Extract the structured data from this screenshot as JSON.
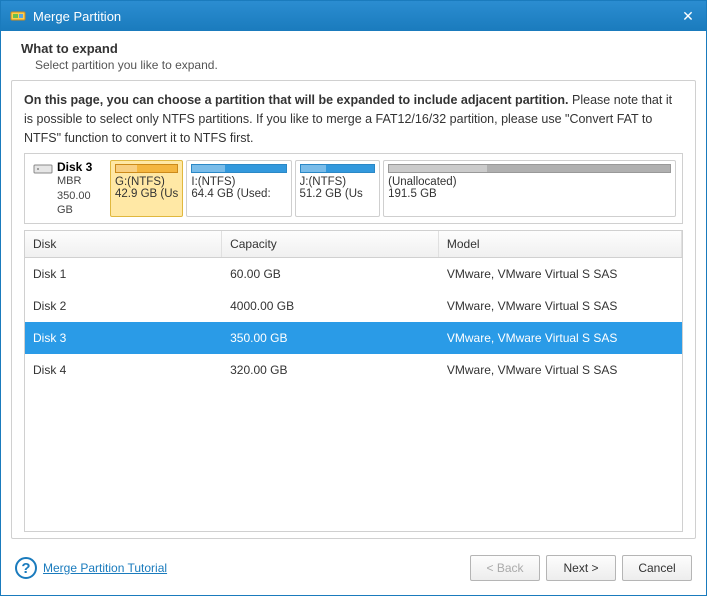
{
  "window": {
    "title": "Merge Partition"
  },
  "header": {
    "title": "What to expand",
    "subtitle": "Select partition you like to expand."
  },
  "description": {
    "bold": "On this page, you can choose a partition that will be expanded to include adjacent partition.",
    "rest": " Please note that it is possible to select only NTFS partitions. If you like to merge a FAT12/16/32 partition, please use \"Convert FAT to NTFS\" function to convert it to NTFS first."
  },
  "diskmap": {
    "disk_label": "Disk 3",
    "scheme": "MBR",
    "size": "350.00 GB",
    "partitions": [
      {
        "id": "G",
        "label": "G:(NTFS)",
        "sub": "42.9 GB (Us",
        "selected": true,
        "unalloc": false
      },
      {
        "id": "I",
        "label": "I:(NTFS)",
        "sub": "64.4 GB (Used:",
        "selected": false,
        "unalloc": false
      },
      {
        "id": "J",
        "label": "J:(NTFS)",
        "sub": "51.2 GB (Us",
        "selected": false,
        "unalloc": false
      },
      {
        "id": "U",
        "label": "(Unallocated)",
        "sub": "191.5 GB",
        "selected": false,
        "unalloc": true
      }
    ]
  },
  "table": {
    "columns": {
      "disk": "Disk",
      "capacity": "Capacity",
      "model": "Model"
    },
    "rows": [
      {
        "disk": "Disk 1",
        "capacity": "60.00 GB",
        "model": "VMware, VMware Virtual S SAS",
        "selected": false
      },
      {
        "disk": "Disk 2",
        "capacity": "4000.00 GB",
        "model": "VMware, VMware Virtual S SAS",
        "selected": false
      },
      {
        "disk": "Disk 3",
        "capacity": "350.00 GB",
        "model": "VMware, VMware Virtual S SAS",
        "selected": true
      },
      {
        "disk": "Disk 4",
        "capacity": "320.00 GB",
        "model": "VMware, VMware Virtual S SAS",
        "selected": false
      }
    ]
  },
  "footer": {
    "tutorial_link": "Merge Partition Tutorial",
    "back": "< Back",
    "next": "Next >",
    "cancel": "Cancel"
  },
  "chart_data": {
    "type": "bar",
    "title": "Disk 3 layout",
    "total_gb": 350.0,
    "series": [
      {
        "name": "G:(NTFS)",
        "size_gb": 42.9,
        "role": "ntfs-partition",
        "selected": true
      },
      {
        "name": "I:(NTFS)",
        "size_gb": 64.4,
        "role": "ntfs-partition",
        "selected": false
      },
      {
        "name": "J:(NTFS)",
        "size_gb": 51.2,
        "role": "ntfs-partition",
        "selected": false
      },
      {
        "name": "(Unallocated)",
        "size_gb": 191.5,
        "role": "unallocated",
        "selected": false
      }
    ]
  }
}
